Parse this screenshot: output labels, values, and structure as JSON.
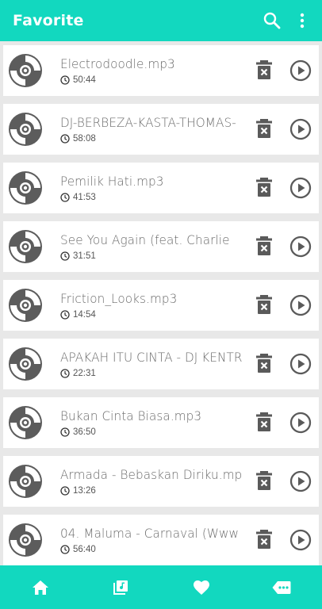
{
  "appbar": {
    "title": "Favorite",
    "search_icon": "search-icon",
    "more_icon": "more-vert-icon"
  },
  "colors": {
    "accent": "#12d8bf",
    "background": "#e8e8e8",
    "card": "#ffffff",
    "icon": "#5a5a5a"
  },
  "songs": [
    {
      "title": "Electrodoodle.mp3",
      "duration": "50:44"
    },
    {
      "title": "DJ-BERBEZA-KASTA-THOMAS-",
      "duration": "58:08"
    },
    {
      "title": "Pemilik Hati.mp3",
      "duration": "41:53"
    },
    {
      "title": "See You Again (feat. Charlie",
      "duration": "31:51"
    },
    {
      "title": "Friction_Looks.mp3",
      "duration": "14:54"
    },
    {
      "title": "APAKAH ITU CINTA - DJ KENTR",
      "duration": "22:31"
    },
    {
      "title": "Bukan Cinta Biasa.mp3",
      "duration": "36:50"
    },
    {
      "title": "Armada - Bebaskan Diriku.mp",
      "duration": "13:26"
    },
    {
      "title": "04. Maluma - Carnaval (Www",
      "duration": "56:40"
    }
  ],
  "bottom_nav": [
    {
      "icon": "home-icon"
    },
    {
      "icon": "library-music-icon"
    },
    {
      "icon": "heart-icon"
    },
    {
      "icon": "label-dots-icon"
    }
  ]
}
